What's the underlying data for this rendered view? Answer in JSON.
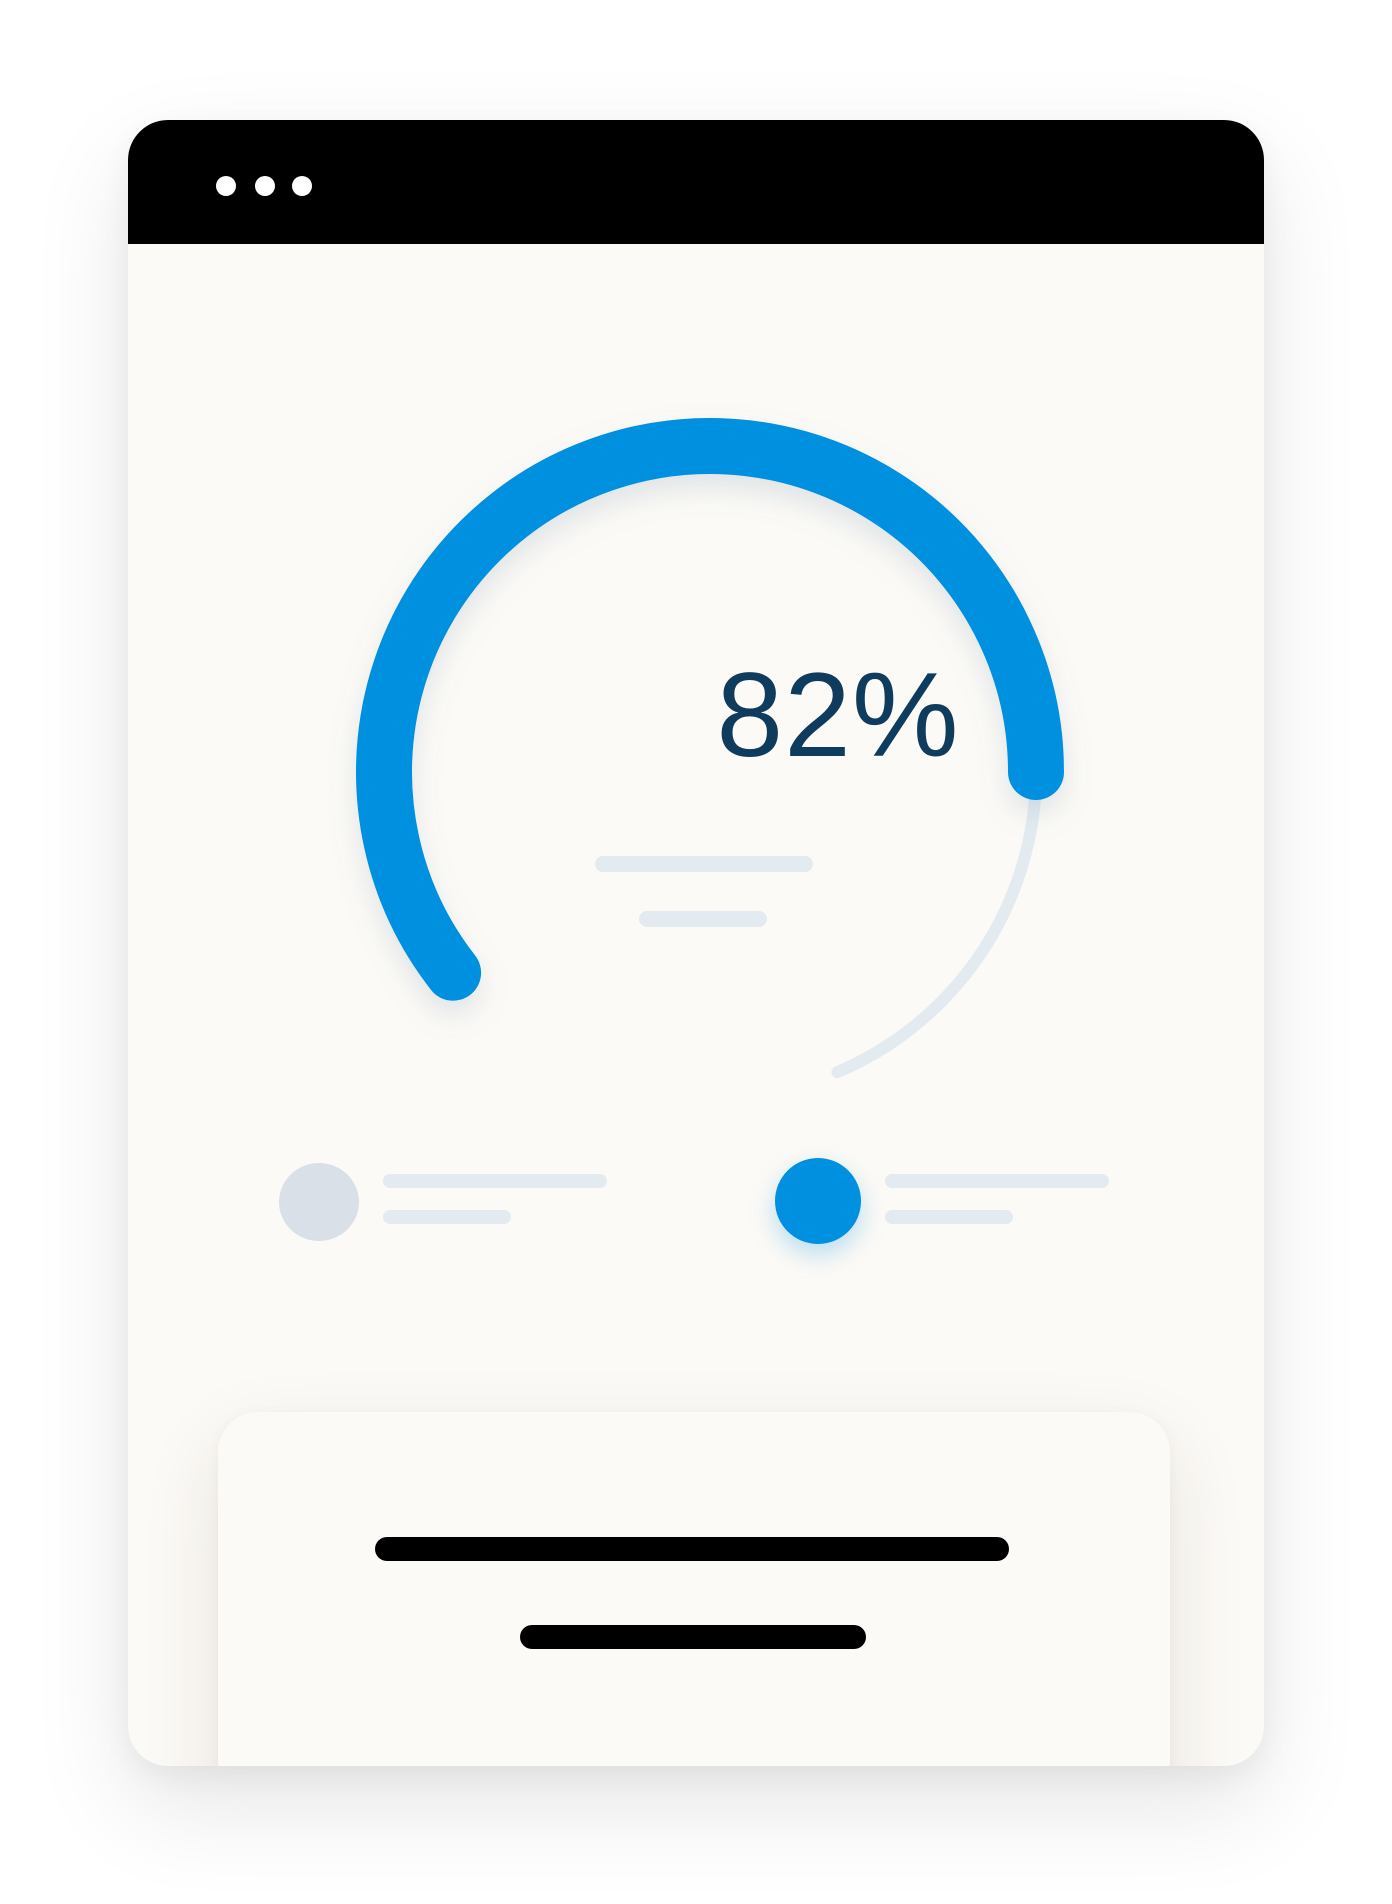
{
  "window": {
    "controls": [
      "window-dot-1",
      "window-dot-2",
      "window-dot-3"
    ]
  },
  "gauge": {
    "value_label": "82%",
    "value": 82,
    "max": 100,
    "colors": {
      "progress": "#0090e0",
      "track": "#e3ebf0",
      "text": "#0f3b5c"
    }
  },
  "legend": {
    "items": [
      {
        "icon": "inactive-dot",
        "color": "#d9e0e8"
      },
      {
        "icon": "active-dot",
        "color": "#0090e0"
      }
    ]
  },
  "card": {
    "lines": 2
  }
}
